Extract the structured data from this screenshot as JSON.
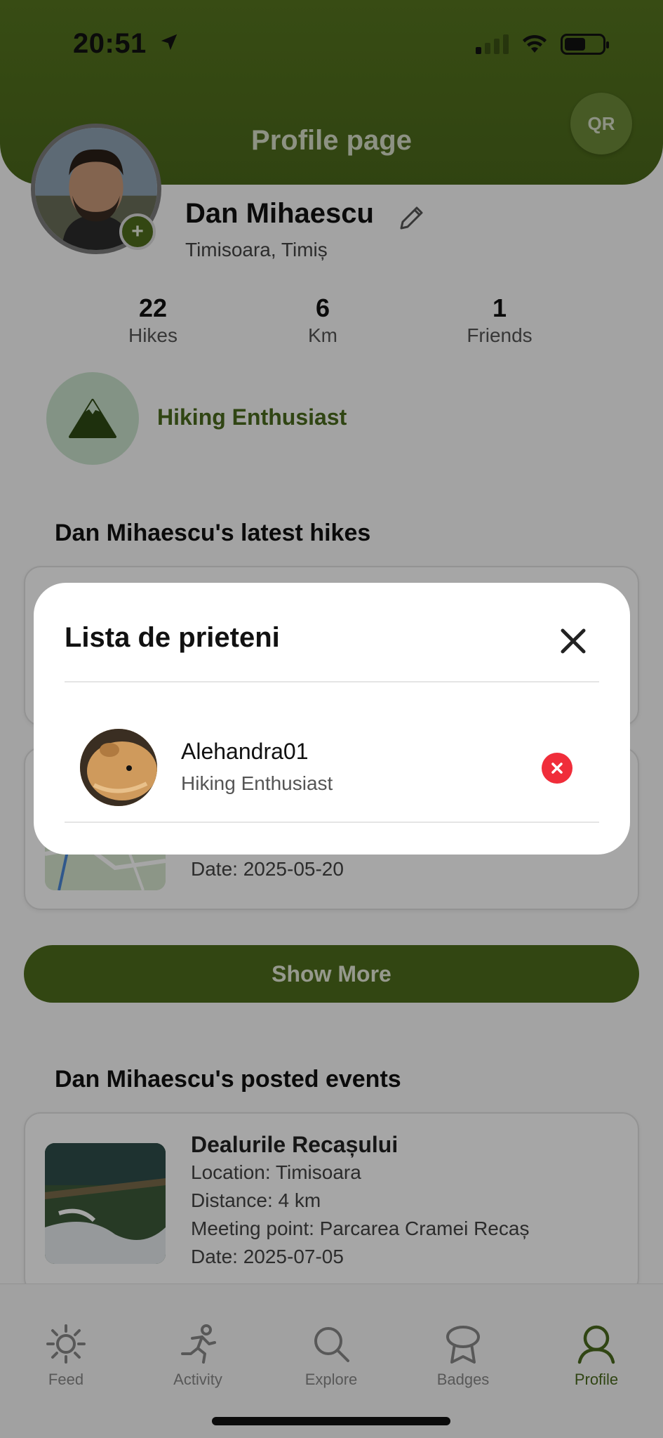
{
  "status_bar": {
    "time": "20:51"
  },
  "header": {
    "title": "Profile page",
    "qr_label": "QR"
  },
  "profile": {
    "name": "Dan Mihaescu",
    "location": "Timisoara, Timiș"
  },
  "stats": [
    {
      "value": "22",
      "label": "Hikes"
    },
    {
      "value": "6",
      "label": "Km"
    },
    {
      "value": "1",
      "label": "Friends"
    }
  ],
  "badge": {
    "title": "Hiking Enthusiast",
    "icon": "mountain-icon"
  },
  "latest_hikes": {
    "title": "Dan Mihaescu's latest hikes",
    "visible_date": "Date: 2025-05-20"
  },
  "show_more_label": "Show More",
  "posted_events": {
    "title": "Dan Mihaescu's posted events",
    "items": [
      {
        "name": "Dealurile Recașului",
        "location": "Location: Timisoara",
        "distance": "Distance: 4 km",
        "meeting_point": "Meeting point: Parcarea Cramei Recaș",
        "date": "Date: 2025-07-05"
      }
    ]
  },
  "tabs": [
    {
      "label": "Feed",
      "icon": "sun-icon"
    },
    {
      "label": "Activity",
      "icon": "runner-icon"
    },
    {
      "label": "Explore",
      "icon": "search-icon"
    },
    {
      "label": "Badges",
      "icon": "badge-icon"
    },
    {
      "label": "Profile",
      "icon": "person-icon",
      "active": true
    }
  ],
  "modal": {
    "title": "Lista de prieteni",
    "friends": [
      {
        "name": "Alehandra01",
        "title": "Hiking Enthusiast"
      }
    ]
  },
  "colors": {
    "brand_green": "#4e6c1d",
    "badge_bg": "#c9e2cd",
    "remove_red": "#f02d3a"
  }
}
